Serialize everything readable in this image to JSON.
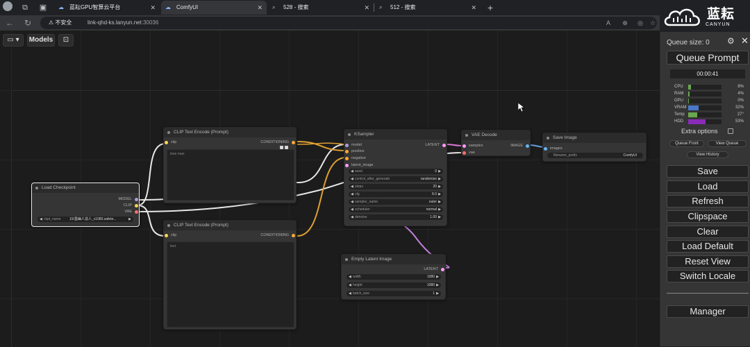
{
  "browser": {
    "tabs": [
      {
        "label": "蓝耘GPU智算云平台"
      },
      {
        "label": "ComfyUI"
      },
      {
        "label": "528 - 搜索"
      },
      {
        "label": "512 - 搜索"
      }
    ],
    "new_tab": "+",
    "security_label": "不安全",
    "url_host": "link-qhd-ks.lanyun.net",
    "url_port": ":30036"
  },
  "logo": {
    "cn": "蓝耘",
    "en": "CANYUN"
  },
  "toolbar": {
    "models_label": "Models"
  },
  "nodes": {
    "load_checkpoint": {
      "title": "Load Checkpoint",
      "outputs": [
        "MODEL",
        "CLIP",
        "VAE"
      ],
      "widget_label": "ckpt_name",
      "widget_value": "15/墨幽人造人_v1080.safete..."
    },
    "clip_pos": {
      "title": "CLIP Text Encode (Prompt)",
      "input": "clip",
      "output": "CONDITIONING",
      "text": "lone man"
    },
    "clip_neg": {
      "title": "CLIP Text Encode (Prompt)",
      "input": "clip",
      "output": "CONDITIONING",
      "text": "text"
    },
    "ksampler": {
      "title": "KSampler",
      "inputs": [
        "model",
        "positive",
        "negative",
        "latent_image"
      ],
      "output": "LATENT",
      "widgets": [
        {
          "label": "seed",
          "value": "0"
        },
        {
          "label": "control_after_generate",
          "value": "randomize"
        },
        {
          "label": "steps",
          "value": "20"
        },
        {
          "label": "cfg",
          "value": "8.0"
        },
        {
          "label": "sampler_name",
          "value": "euler"
        },
        {
          "label": "scheduler",
          "value": "normal"
        },
        {
          "label": "denoise",
          "value": "1.00"
        }
      ]
    },
    "vae_decode": {
      "title": "VAE Decode",
      "inputs": [
        "samples",
        "vae"
      ],
      "output": "IMAGE"
    },
    "save_image": {
      "title": "Save Image",
      "input": "images",
      "widget_label": "filename_prefix",
      "widget_value": "ComfyUI"
    },
    "empty_latent": {
      "title": "Empty Latent Image",
      "output": "LATENT",
      "widgets": [
        {
          "label": "width",
          "value": "1080"
        },
        {
          "label": "height",
          "value": "1080"
        },
        {
          "label": "batch_size",
          "value": "1"
        }
      ]
    }
  },
  "panel": {
    "queue_size": "Queue size: 0",
    "queue_prompt": "Queue Prompt",
    "timer": "00:00:41",
    "stats": [
      {
        "label": "CPU",
        "value": "8%",
        "fraction": 0.08,
        "color": "#6aa84f"
      },
      {
        "label": "RAM",
        "value": "4%",
        "fraction": 0.04,
        "color": "#6aa84f"
      },
      {
        "label": "GPU",
        "value": "0%",
        "fraction": 0.0,
        "color": "#6aa84f"
      },
      {
        "label": "VRAM",
        "value": "32%",
        "fraction": 0.32,
        "color": "#4a78c8"
      },
      {
        "label": "Temp",
        "value": "27°",
        "fraction": 0.27,
        "color": "#6aa84f"
      },
      {
        "label": "HDD",
        "value": "53%",
        "fraction": 0.53,
        "color": "#8a2bb8"
      }
    ],
    "extra_options": "Extra options",
    "queue_front": "Queue Front",
    "view_queue": "View Queue",
    "view_history": "View History",
    "buttons": [
      "Save",
      "Load",
      "Refresh",
      "Clipspace",
      "Clear",
      "Load Default",
      "Reset View",
      "Switch Locale"
    ],
    "manager": "Manager"
  },
  "colors": {
    "model": "#b39ddb",
    "clip": "#ffd54f",
    "vae": "#ff6e6e",
    "conditioning": "#ffa931",
    "latent": "#ff9cf9",
    "image": "#64b5f6"
  }
}
